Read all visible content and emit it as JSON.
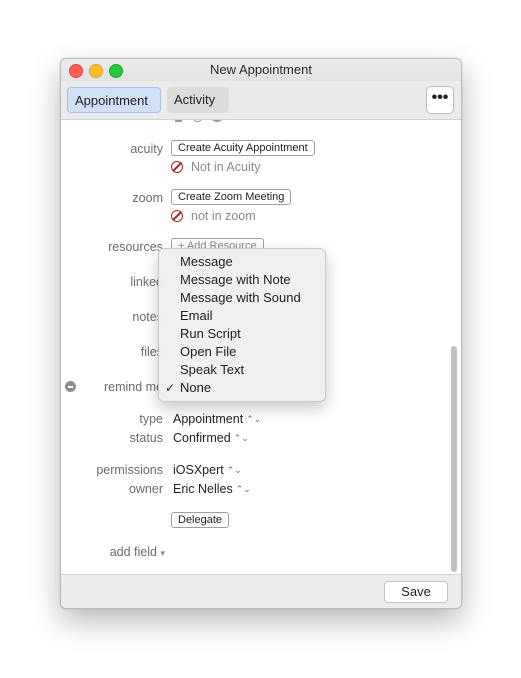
{
  "window": {
    "title": "New Appointment"
  },
  "tabs": {
    "appointment": "Appointment",
    "activity": "Activity"
  },
  "toolbar": {
    "more_label": "•••"
  },
  "form": {
    "acuity": {
      "label": "acuity",
      "button": "Create Acuity Appointment",
      "status": "Not in Acuity"
    },
    "zoom": {
      "label": "zoom",
      "button": "Create Zoom Meeting",
      "status": "not in zoom"
    },
    "resources": {
      "label": "resources",
      "button": "+ Add Resource"
    },
    "linked": {
      "label": "linked"
    },
    "notes": {
      "label": "notes"
    },
    "files": {
      "label": "files"
    },
    "remind_me": {
      "label": "remind me"
    },
    "type": {
      "label": "type",
      "value": "Appointment"
    },
    "status": {
      "label": "status",
      "value": "Confirmed"
    },
    "permissions": {
      "label": "permissions",
      "value": "iOSXpert"
    },
    "owner": {
      "label": "owner",
      "value": "Eric Nelles"
    },
    "delegate_button": "Delegate",
    "add_field": "add field"
  },
  "menu": {
    "items": [
      "Message",
      "Message with Note",
      "Message with Sound",
      "Email",
      "Run Script",
      "Open File",
      "Speak Text",
      "None"
    ],
    "selected": "None",
    "check_glyph": "✓"
  },
  "footer": {
    "save_label": "Save"
  },
  "icons": {
    "updown": "⌃⌄",
    "dropdown": "▾"
  }
}
